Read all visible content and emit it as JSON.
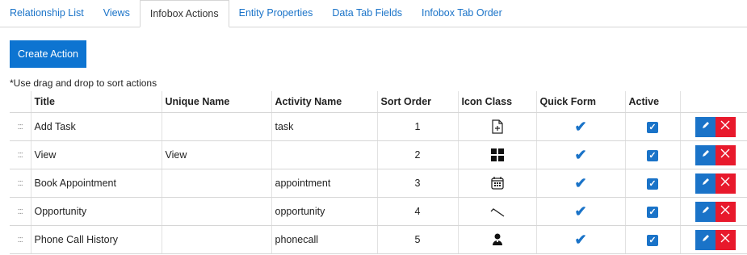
{
  "tabs": [
    {
      "label": "Relationship List",
      "active": false
    },
    {
      "label": "Views",
      "active": false
    },
    {
      "label": "Infobox Actions",
      "active": true
    },
    {
      "label": "Entity Properties",
      "active": false
    },
    {
      "label": "Data Tab Fields",
      "active": false
    },
    {
      "label": "Infobox Tab Order",
      "active": false
    }
  ],
  "create_button": "Create Action",
  "note": "*Use drag and drop to sort actions",
  "columns": [
    "Title",
    "Unique Name",
    "Activity Name",
    "Sort Order",
    "Icon Class",
    "Quick Form",
    "Active"
  ],
  "drag_handle": ":::",
  "rows": [
    {
      "title": "Add Task",
      "unique": "",
      "activity": "task",
      "sort": "1",
      "icon": "task-document-icon",
      "quick_form": true,
      "active": true
    },
    {
      "title": "View",
      "unique": "View",
      "activity": "",
      "sort": "2",
      "icon": "grid-tiles-icon",
      "quick_form": true,
      "active": true
    },
    {
      "title": "Book Appointment",
      "unique": "",
      "activity": "appointment",
      "sort": "3",
      "icon": "calendar-icon",
      "quick_form": true,
      "active": true
    },
    {
      "title": "Opportunity",
      "unique": "",
      "activity": "opportunity",
      "sort": "4",
      "icon": "trend-line-icon",
      "quick_form": true,
      "active": true
    },
    {
      "title": "Phone Call History",
      "unique": "",
      "activity": "phonecall",
      "sort": "5",
      "icon": "phone-user-icon",
      "quick_form": true,
      "active": true
    }
  ],
  "colors": {
    "accent": "#1a73c8",
    "button": "#0d74d1",
    "delete": "#e8192c"
  }
}
